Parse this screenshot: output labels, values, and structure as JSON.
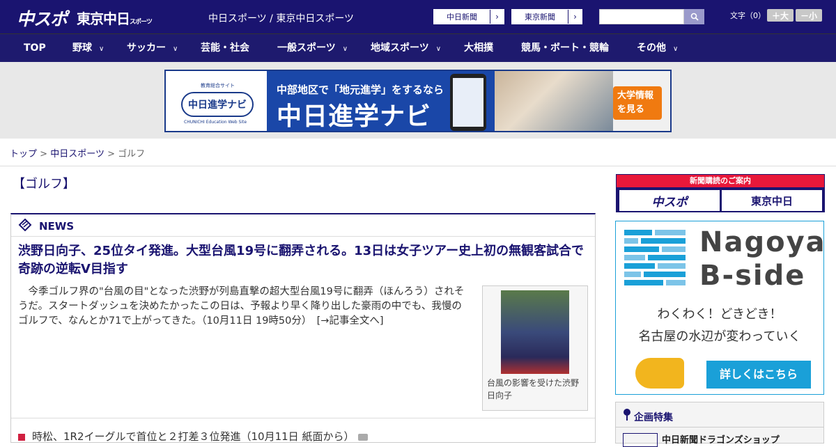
{
  "header": {
    "logo_chuspo": "中スポ",
    "logo_tokyo": "東京中日",
    "logo_tokyo_small": "スポーツ",
    "site_title": "中日スポーツ / 東京中日スポーツ",
    "paper_links": [
      {
        "label": "中日新聞",
        "arrow": "›"
      },
      {
        "label": "東京新聞",
        "arrow": "›"
      }
    ],
    "search_placeholder": "",
    "font_size_label": "文字（0）",
    "font_larger": "＋大",
    "font_smaller": "－小"
  },
  "nav": [
    {
      "label": "TOP",
      "has_menu": false
    },
    {
      "label": "野球",
      "has_menu": true
    },
    {
      "label": "サッカー",
      "has_menu": true
    },
    {
      "label": "芸能・社会",
      "has_menu": false
    },
    {
      "label": "一般スポーツ",
      "has_menu": true
    },
    {
      "label": "地域スポーツ",
      "has_menu": true
    },
    {
      "label": "大相撲",
      "has_menu": false
    },
    {
      "label": "競馬・ボート・競輪",
      "has_menu": false
    },
    {
      "label": "その他",
      "has_menu": true
    }
  ],
  "banner": {
    "site_badge": "教育総合サイト",
    "logo_text": "中日進学ナビ",
    "logo_sub": "CHUNICHI Education Web Site",
    "copy_line1": "中部地区で「地元進学」をするなら",
    "copy_line2": "中日進学ナビ",
    "cta_line1": "大学情報",
    "cta_line2": "を見る"
  },
  "breadcrumb": {
    "items": [
      "トップ",
      "中日スポーツ"
    ],
    "current": "ゴルフ",
    "separator": ">"
  },
  "category_title": "【ゴルフ】",
  "news": {
    "label": "NEWS",
    "headline": "渋野日向子、25位タイ発進。大型台風19号に翻弄される。13日は女子ツアー史上初の無観客試合で奇跡の逆転V目指す",
    "lead": "今季ゴルフ界の\"台風の目\"となった渋野が列島直撃の超大型台風19号に翻弄（ほんろう）されそうだ。スタートダッシュを決めたかったこの日は、予報より早く降り出した豪雨の中でも、我慢のゴルフで、なんとか71で上がってきた。（10月11日 19時50分）　[→記事全文へ]",
    "photo_caption": "台風の影響を受けた渋野日向子",
    "second_item": "時松、1R2イーグルで首位と２打差３位発進（10月11日 紙面から）"
  },
  "sidebar": {
    "subscribe_label": "新聞購読のご案内",
    "subscribe_chuspo": "中スポ",
    "subscribe_tokyo": "東京中日",
    "ad_title_line1": "Nagoya",
    "ad_title_line2": "B-side",
    "ad_copy_line1": "わくわく！どきどき！",
    "ad_copy_line2": "名古屋の水辺が変わっていく",
    "ad_button": "詳しくはこちら",
    "feature_label": "企画特集",
    "feature_item": "中日新聞ドラゴンズショップ"
  },
  "colors": {
    "brand_navy": "#1a1470",
    "accent_red": "#e8183a",
    "ad_blue": "#1aa0d8"
  }
}
